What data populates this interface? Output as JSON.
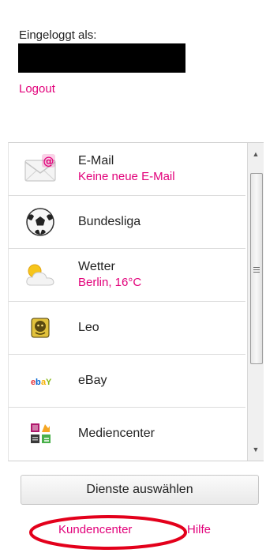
{
  "account": {
    "logged_in_label": "Eingeloggt als:",
    "logout_label": "Logout"
  },
  "services": [
    {
      "title": "E-Mail",
      "subtitle": "Keine neue E-Mail",
      "icon": "mail-icon"
    },
    {
      "title": "Bundesliga",
      "subtitle": "",
      "icon": "soccer-ball-icon"
    },
    {
      "title": "Wetter",
      "subtitle": "Berlin, 16°C",
      "icon": "weather-icon"
    },
    {
      "title": "Leo",
      "subtitle": "",
      "icon": "leo-icon"
    },
    {
      "title": "eBay",
      "subtitle": "",
      "icon": "ebay-icon"
    },
    {
      "title": "Mediencenter",
      "subtitle": "",
      "icon": "mediencenter-icon"
    }
  ],
  "actions": {
    "select_services": "Dienste auswählen"
  },
  "footer": {
    "customer_center": "Kundencenter",
    "help": "Hilfe"
  },
  "colors": {
    "accent": "#e2007a",
    "annotation": "#e3001b"
  }
}
